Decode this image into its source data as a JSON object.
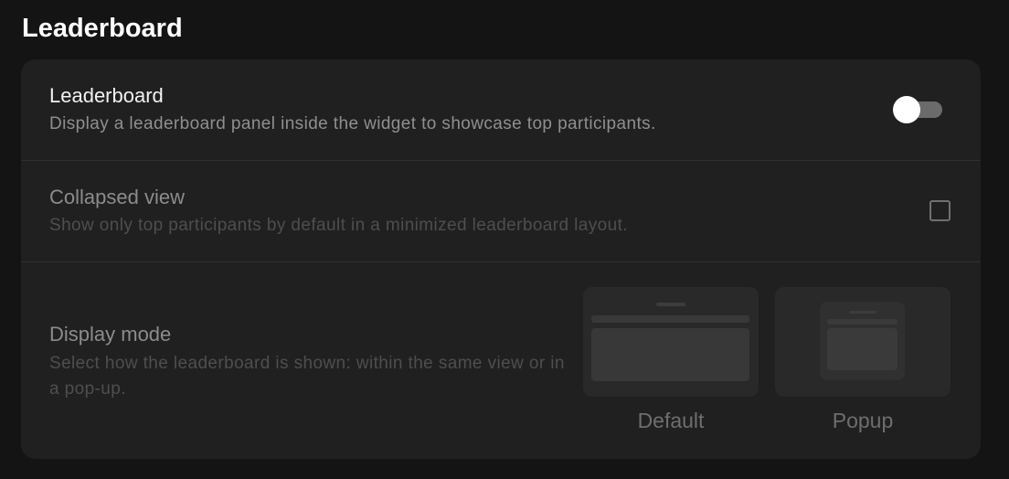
{
  "page": {
    "title": "Leaderboard"
  },
  "settings": {
    "leaderboard": {
      "title": "Leaderboard",
      "description": "Display a leaderboard panel inside the widget to showcase top participants.",
      "enabled": false
    },
    "collapsed_view": {
      "title": "Collapsed view",
      "description": "Show only top participants by default in a minimized leaderboard layout.",
      "checked": false,
      "disabled": true
    },
    "display_mode": {
      "title": "Display mode",
      "description": "Select how the leaderboard is shown: within the same view or in a pop-up.",
      "disabled": true,
      "options": [
        {
          "label": "Default",
          "icon": "default-layout-preview"
        },
        {
          "label": "Popup",
          "icon": "popup-layout-preview"
        }
      ]
    }
  },
  "colors": {
    "background": "#141414",
    "card": "#202020",
    "toggle_track_off": "#6b6b6b",
    "toggle_knob": "#ffffff"
  }
}
